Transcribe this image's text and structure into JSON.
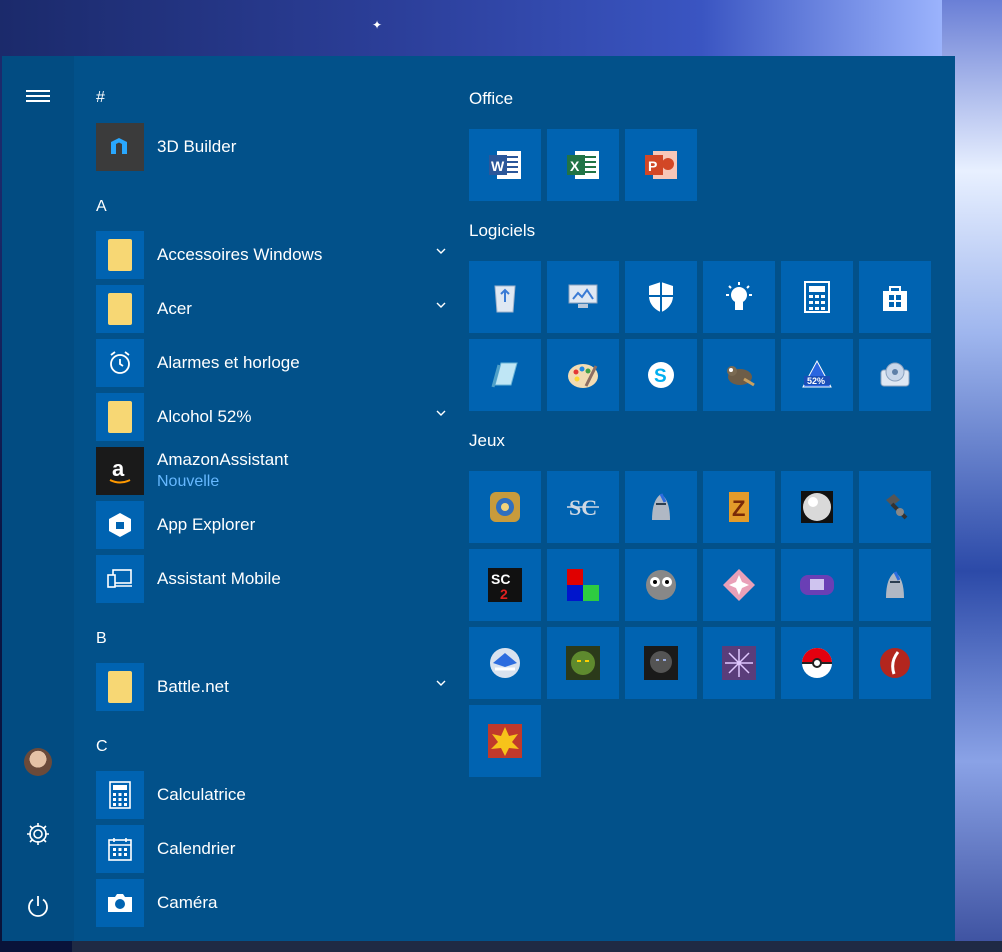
{
  "rail": {
    "menu_icon": "hamburger-icon",
    "user_icon": "user-avatar-icon",
    "settings_icon": "gear-icon",
    "power_icon": "power-icon"
  },
  "app_list": {
    "sections": [
      {
        "letter": "#",
        "apps": [
          {
            "label": "3D Builder",
            "icon": "3d-builder-icon"
          }
        ]
      },
      {
        "letter": "A",
        "apps": [
          {
            "label": "Accessoires Windows",
            "icon": "folder-icon",
            "expandable": true
          },
          {
            "label": "Acer",
            "icon": "folder-icon",
            "expandable": true
          },
          {
            "label": "Alarmes et horloge",
            "icon": "alarm-clock-icon"
          },
          {
            "label": "Alcohol 52%",
            "icon": "folder-icon",
            "expandable": true
          },
          {
            "label": "AmazonAssistant",
            "sub": "Nouvelle",
            "icon": "amazon-icon"
          },
          {
            "label": "App Explorer",
            "icon": "app-explorer-icon"
          },
          {
            "label": "Assistant Mobile",
            "icon": "mobile-assistant-icon"
          }
        ]
      },
      {
        "letter": "B",
        "apps": [
          {
            "label": "Battle.net",
            "icon": "folder-icon",
            "expandable": true
          }
        ]
      },
      {
        "letter": "C",
        "apps": [
          {
            "label": "Calculatrice",
            "icon": "calculator-icon"
          },
          {
            "label": "Calendrier",
            "icon": "calendar-icon"
          },
          {
            "label": "Caméra",
            "icon": "camera-icon"
          }
        ]
      }
    ]
  },
  "tile_groups": {
    "office": {
      "title": "Office",
      "tiles": [
        "word-icon",
        "excel-icon",
        "powerpoint-icon"
      ]
    },
    "logiciels": {
      "title": "Logiciels",
      "tiles": [
        "recycle-bin-icon",
        "monitor-icon",
        "defender-shield-icon",
        "lightbulb-icon",
        "calculator-icon",
        "store-icon",
        "notepad-icon",
        "paint-icon",
        "skype-icon",
        "gimp-icon",
        "alcohol-52-icon",
        "disk-utility-icon"
      ]
    },
    "jeux": {
      "title": "Jeux",
      "tiles": [
        "hearthstone-icon",
        "starcraft-icon",
        "diablo-icon",
        "zone-icon",
        "ball-icon",
        "hammer-icon",
        "starcraft2-icon",
        "tetris-icon",
        "face-icon",
        "star-gem-icon",
        "gameboy-icon",
        "diablo2-icon",
        "warcraft-icon",
        "orc-icon",
        "undead-icon",
        "rune-icon",
        "pokeball-icon",
        "feather-icon",
        "explosion-icon"
      ]
    }
  },
  "colors": {
    "panel": "#02518a",
    "tile": "#0063b1",
    "accent_text": "#66b8ff"
  }
}
